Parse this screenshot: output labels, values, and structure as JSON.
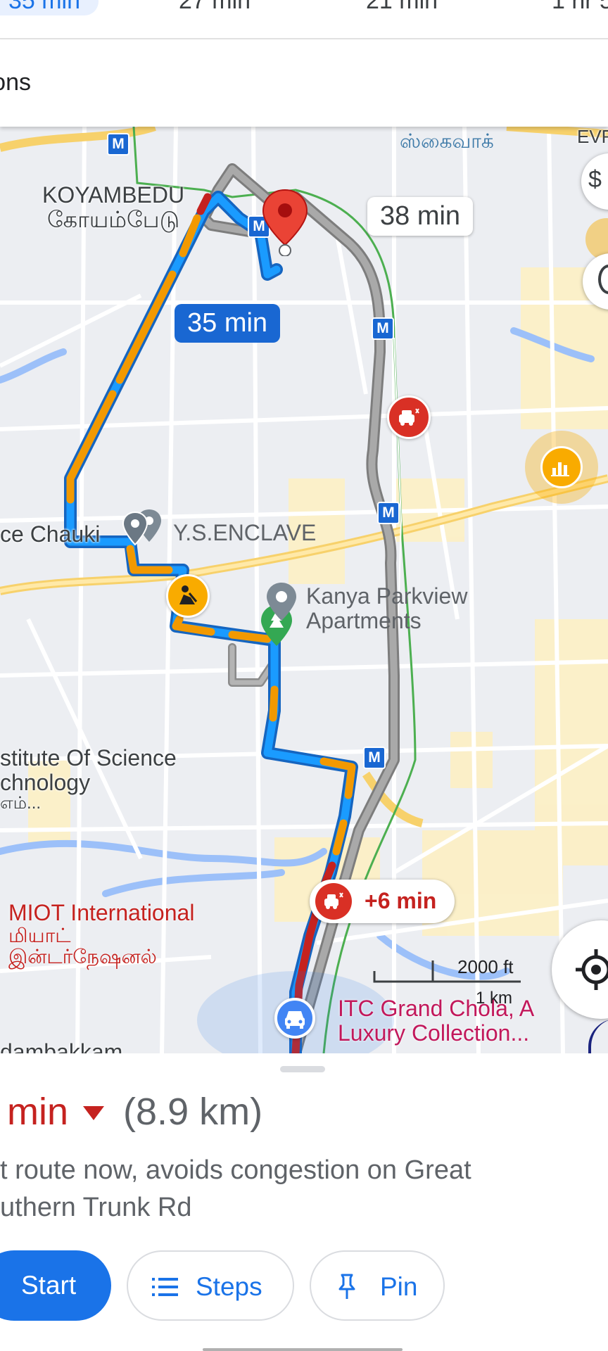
{
  "travel_modes": [
    {
      "label": "35 min",
      "selected": true
    },
    {
      "label": "27 min",
      "selected": false
    },
    {
      "label": "21 min",
      "selected": false
    },
    {
      "label": "1 hr 5",
      "selected": false
    }
  ],
  "route_options_label": "Options",
  "map": {
    "route_times": {
      "selected": "35 min",
      "alternate": "38 min"
    },
    "traffic_delay": "+6 min",
    "scale": {
      "feet": "2000 ft",
      "km": "1 km"
    },
    "places": {
      "koyambedu_en": "KOYAMBEDU",
      "koyambedu_ta": "கோயம்பேடு",
      "skywalk_ta": "ஸ்கைவாக்",
      "police_chauki": "ce Chauki",
      "ys_enclave": "Y.S.ENCLAVE",
      "kanya_line1": "Kanya Parkview",
      "kanya_line2": "Apartments",
      "institute_line1": "stitute Of Science",
      "institute_line2": "chnology",
      "institute_line3": "எம்...",
      "miot_line1": "MIOT International",
      "miot_line2": "மியாட்",
      "miot_line3": "இன்டர்நேஷனல்",
      "itc_line1": "ITC Grand Chola, A",
      "itc_line2": "Luxury Collection...",
      "nandambakkam": "dambakkam",
      "evr": "EVR"
    },
    "metro_marker": "M",
    "icons": [
      "destination-pin-icon",
      "origin-car-icon",
      "traffic-incident-icon",
      "road-works-icon",
      "park-icon",
      "place-pin-icon",
      "layers-icon",
      "compass-icon",
      "my-location-icon"
    ]
  },
  "summary": {
    "time": "min",
    "distance": "(8.9 km)",
    "description_line1": "t route now, avoids congestion on Great",
    "description_line2": "uthern Trunk Rd"
  },
  "actions": {
    "start": "Start",
    "steps": "Steps",
    "pin": "Pin"
  },
  "colors": {
    "accent": "#1a73e8",
    "traffic_red": "#c5221f",
    "traffic_orange": "#f29900",
    "route_blue": "#1a9bff"
  }
}
